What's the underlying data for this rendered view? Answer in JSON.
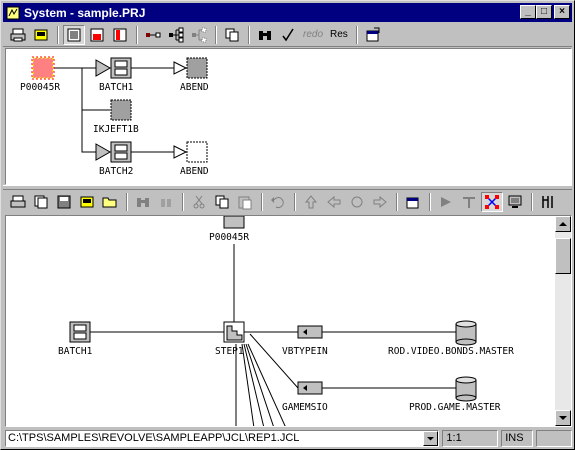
{
  "window": {
    "title": "System - sample.PRJ"
  },
  "title_buttons": {
    "minimize": "_",
    "maximize": "□",
    "close": "×"
  },
  "toolbar1": {
    "redo_label": "redo",
    "res_label": "Res"
  },
  "top_graph": {
    "nodes": {
      "root": "P00045R",
      "batch1": "BATCH1",
      "abend1": "ABEND",
      "ikjeft": "IKJEFT1B",
      "batch2": "BATCH2",
      "abend2": "ABEND"
    }
  },
  "bottom_graph": {
    "nodes": {
      "root": "P00045R",
      "batch1": "BATCH1",
      "step": "STEP1",
      "vbtypein": "VBTYPEIN",
      "bonds": "ROD.VIDEO.BONDS.MASTER",
      "gamemsio": "GAMEMSIO",
      "game": "PROD.GAME.MASTER"
    }
  },
  "statusbar": {
    "path": "C:\\TPS\\SAMPLES\\REVOLVE\\SAMPLEAPP\\JCL\\REP1.JCL",
    "position": "1:1",
    "mode": "INS"
  },
  "colors": {
    "title_bg": "#000080",
    "face": "#c0c0c0",
    "select": "#ff0000"
  }
}
